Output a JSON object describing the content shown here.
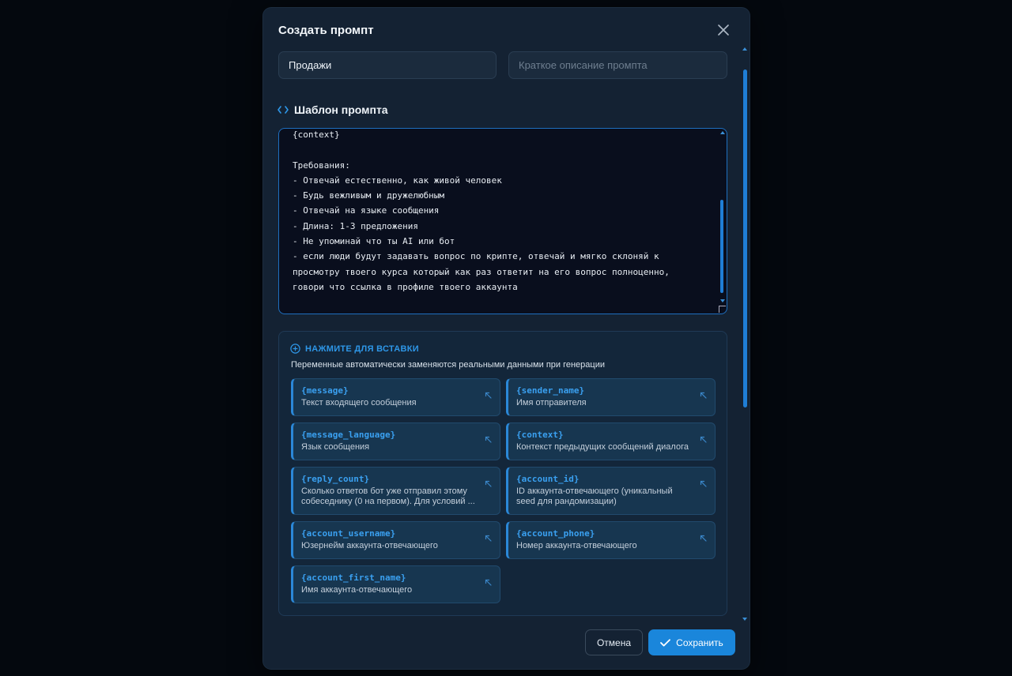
{
  "modal": {
    "title": "Создать промпт",
    "close_icon": "close-icon"
  },
  "form": {
    "name_value": "Продажи",
    "name_placeholder": "",
    "description_value": "",
    "description_placeholder": "Краткое описание промпта"
  },
  "template": {
    "section_label": "Шаблон промпта",
    "icon": "code-icon",
    "text": "{context}\n\nТребования:\n- Отвечай естественно, как живой человек\n- Будь вежливым и дружелюбным\n- Отвечай на языке сообщения\n- Длина: 1-3 предложения\n- Не упоминай что ты AI или бот\n- если люди будут задавать вопрос по крипте, отвечай и мягко склоняй к просмотру твоего курса который как раз ответит на его вопрос полноценно, говори что ссылка в профиле твоего аккаунта"
  },
  "variables": {
    "heading": "НАЖМИТЕ ДЛЯ ВСТАВКИ",
    "heading_icon": "plus-circle-icon",
    "subtitle": "Переменные автоматически заменяются реальными данными при генерации",
    "items": [
      {
        "code": "{message}",
        "desc": "Текст входящего сообщения"
      },
      {
        "code": "{sender_name}",
        "desc": "Имя отправителя"
      },
      {
        "code": "{message_language}",
        "desc": "Язык сообщения"
      },
      {
        "code": "{context}",
        "desc": "Контекст предыдущих сообщений диалога"
      },
      {
        "code": "{reply_count}",
        "desc": "Сколько ответов бот уже отправил этому собеседнику (0 на первом). Для условий ..."
      },
      {
        "code": "{account_id}",
        "desc": "ID аккаунта-отвечающего (уникальный seed для рандомизации)"
      },
      {
        "code": "{account_username}",
        "desc": "Юзернейм аккаунта-отвечающего"
      },
      {
        "code": "{account_phone}",
        "desc": "Номер аккаунта-отвечающего"
      },
      {
        "code": "{account_first_name}",
        "desc": "Имя аккаунта-отвечающего"
      }
    ]
  },
  "footer": {
    "cancel_label": "Отмена",
    "save_label": "Сохранить",
    "save_icon": "check-icon"
  },
  "colors": {
    "accent": "#1a86db",
    "modal_bg": "#142233",
    "code": "#3aa0f0"
  }
}
